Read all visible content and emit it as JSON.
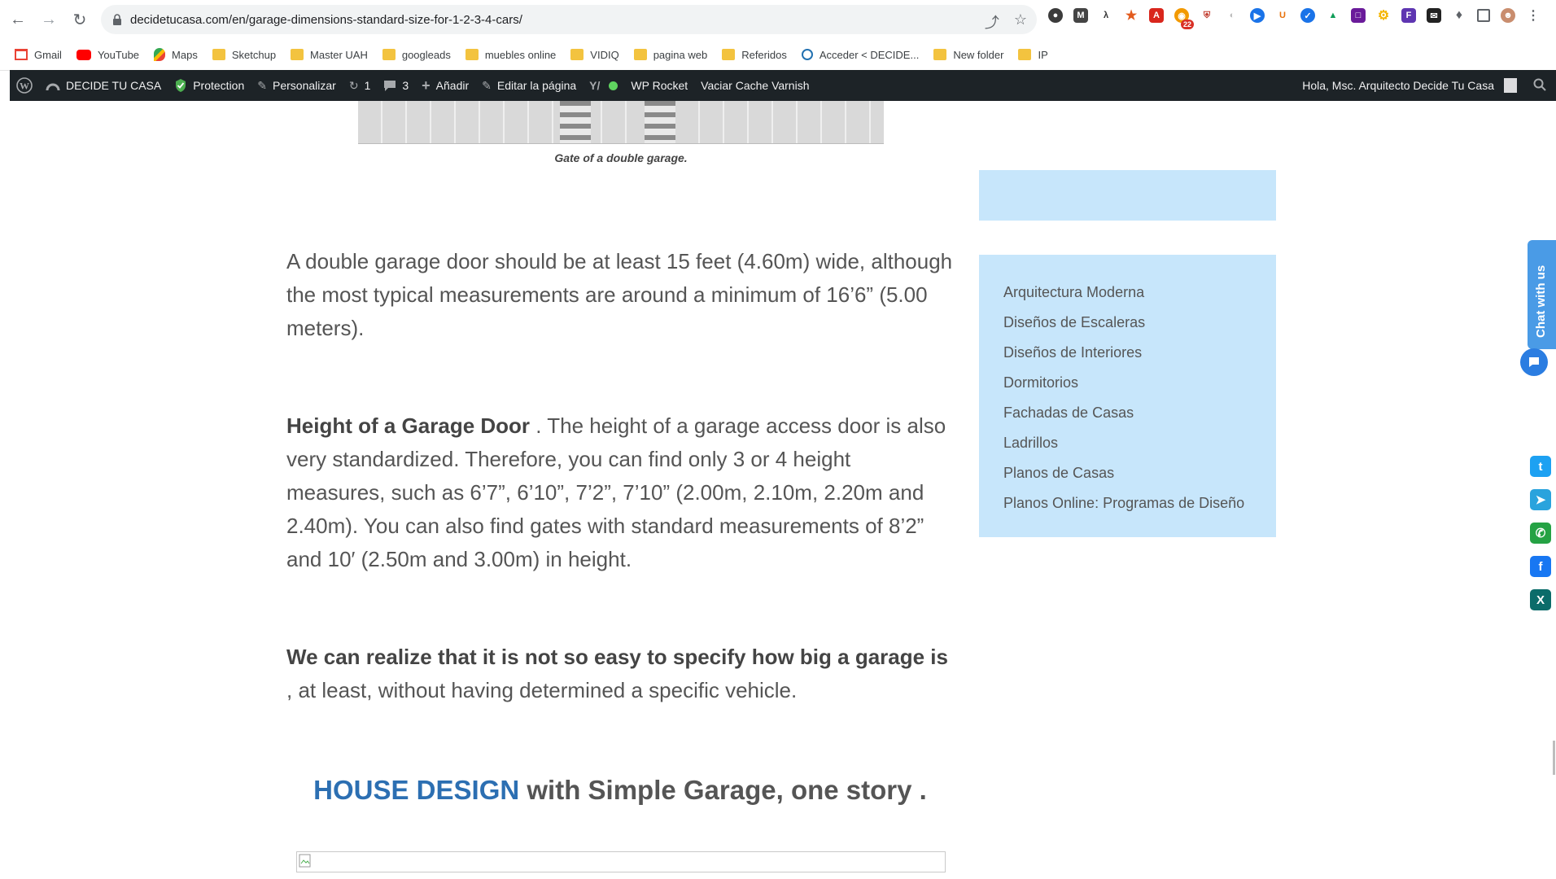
{
  "browser": {
    "url": "decidetucasa.com/en/garage-dimensions-standard-size-for-1-2-3-4-cars/",
    "extension_badge": "22"
  },
  "bookmarks": [
    {
      "label": "Gmail",
      "type": "gmail"
    },
    {
      "label": "YouTube",
      "type": "youtube"
    },
    {
      "label": "Maps",
      "type": "maps"
    },
    {
      "label": "Sketchup",
      "type": "folder"
    },
    {
      "label": "Master UAH",
      "type": "folder"
    },
    {
      "label": "googleads",
      "type": "folder"
    },
    {
      "label": "muebles online",
      "type": "folder"
    },
    {
      "label": "VIDIQ",
      "type": "folder"
    },
    {
      "label": "pagina web",
      "type": "folder"
    },
    {
      "label": "Referidos",
      "type": "folder"
    },
    {
      "label": "Acceder < DECIDE...",
      "type": "site"
    },
    {
      "label": "New folder",
      "type": "folder"
    },
    {
      "label": "IP",
      "type": "folder"
    }
  ],
  "wpbar": {
    "site_name": "DECIDE TU CASA",
    "protection": "Protection",
    "customize": "Personalizar",
    "updates_count": "1",
    "comments_count": "3",
    "add_new": "Añadir",
    "edit_page": "Editar la página",
    "wp_rocket": "WP Rocket",
    "varnish": "Vaciar Cache Varnish",
    "greeting": "Hola, Msc. Arquitecto Decide Tu Casa"
  },
  "article": {
    "caption": "Gate of a double garage.",
    "p1": "A double garage door should be at least 15 feet (4.60m) wide, although the most typical measurements are around a minimum of 16’6” (5.00 meters).",
    "p2_bold": "Height of a Garage Door",
    "p2_rest": " . The height of a garage access door is also very standardized. Therefore, you can find only 3 or 4 height measures, such as 6’7”, 6’10”, 7’2”, 7’10” (2.00m, 2.10m, 2.20m and 2.40m). You can also find gates with standard measurements of 8’2” and 10′ (2.50m and 3.00m) in height.",
    "p3_bold": "We can realize that it is not so easy to specify how big a garage is",
    "p3_rest": " , at least, without having determined a specific vehicle.",
    "h2_accent": "HOUSE DESIGN",
    "h2_rest": " with Simple Garage, one story ."
  },
  "sidebar": {
    "categories": [
      "Arquitectura Moderna",
      "Diseños de Escaleras",
      "Diseños de Interiores",
      "Dormitorios",
      "Fachadas de Casas",
      "Ladrillos",
      "Planos de Casas",
      "Planos Online: Programas de Diseño"
    ]
  },
  "chat": {
    "label": "Chat with us"
  },
  "social": [
    {
      "name": "twitter",
      "color": "#1da1f2",
      "glyph": "t"
    },
    {
      "name": "telegram",
      "color": "#2aa3dd",
      "glyph": "➤"
    },
    {
      "name": "whatsapp",
      "color": "#25a244",
      "glyph": "✆"
    },
    {
      "name": "facebook",
      "color": "#1877f2",
      "glyph": "f"
    },
    {
      "name": "xing",
      "color": "#0b6c6a",
      "glyph": "X"
    }
  ]
}
